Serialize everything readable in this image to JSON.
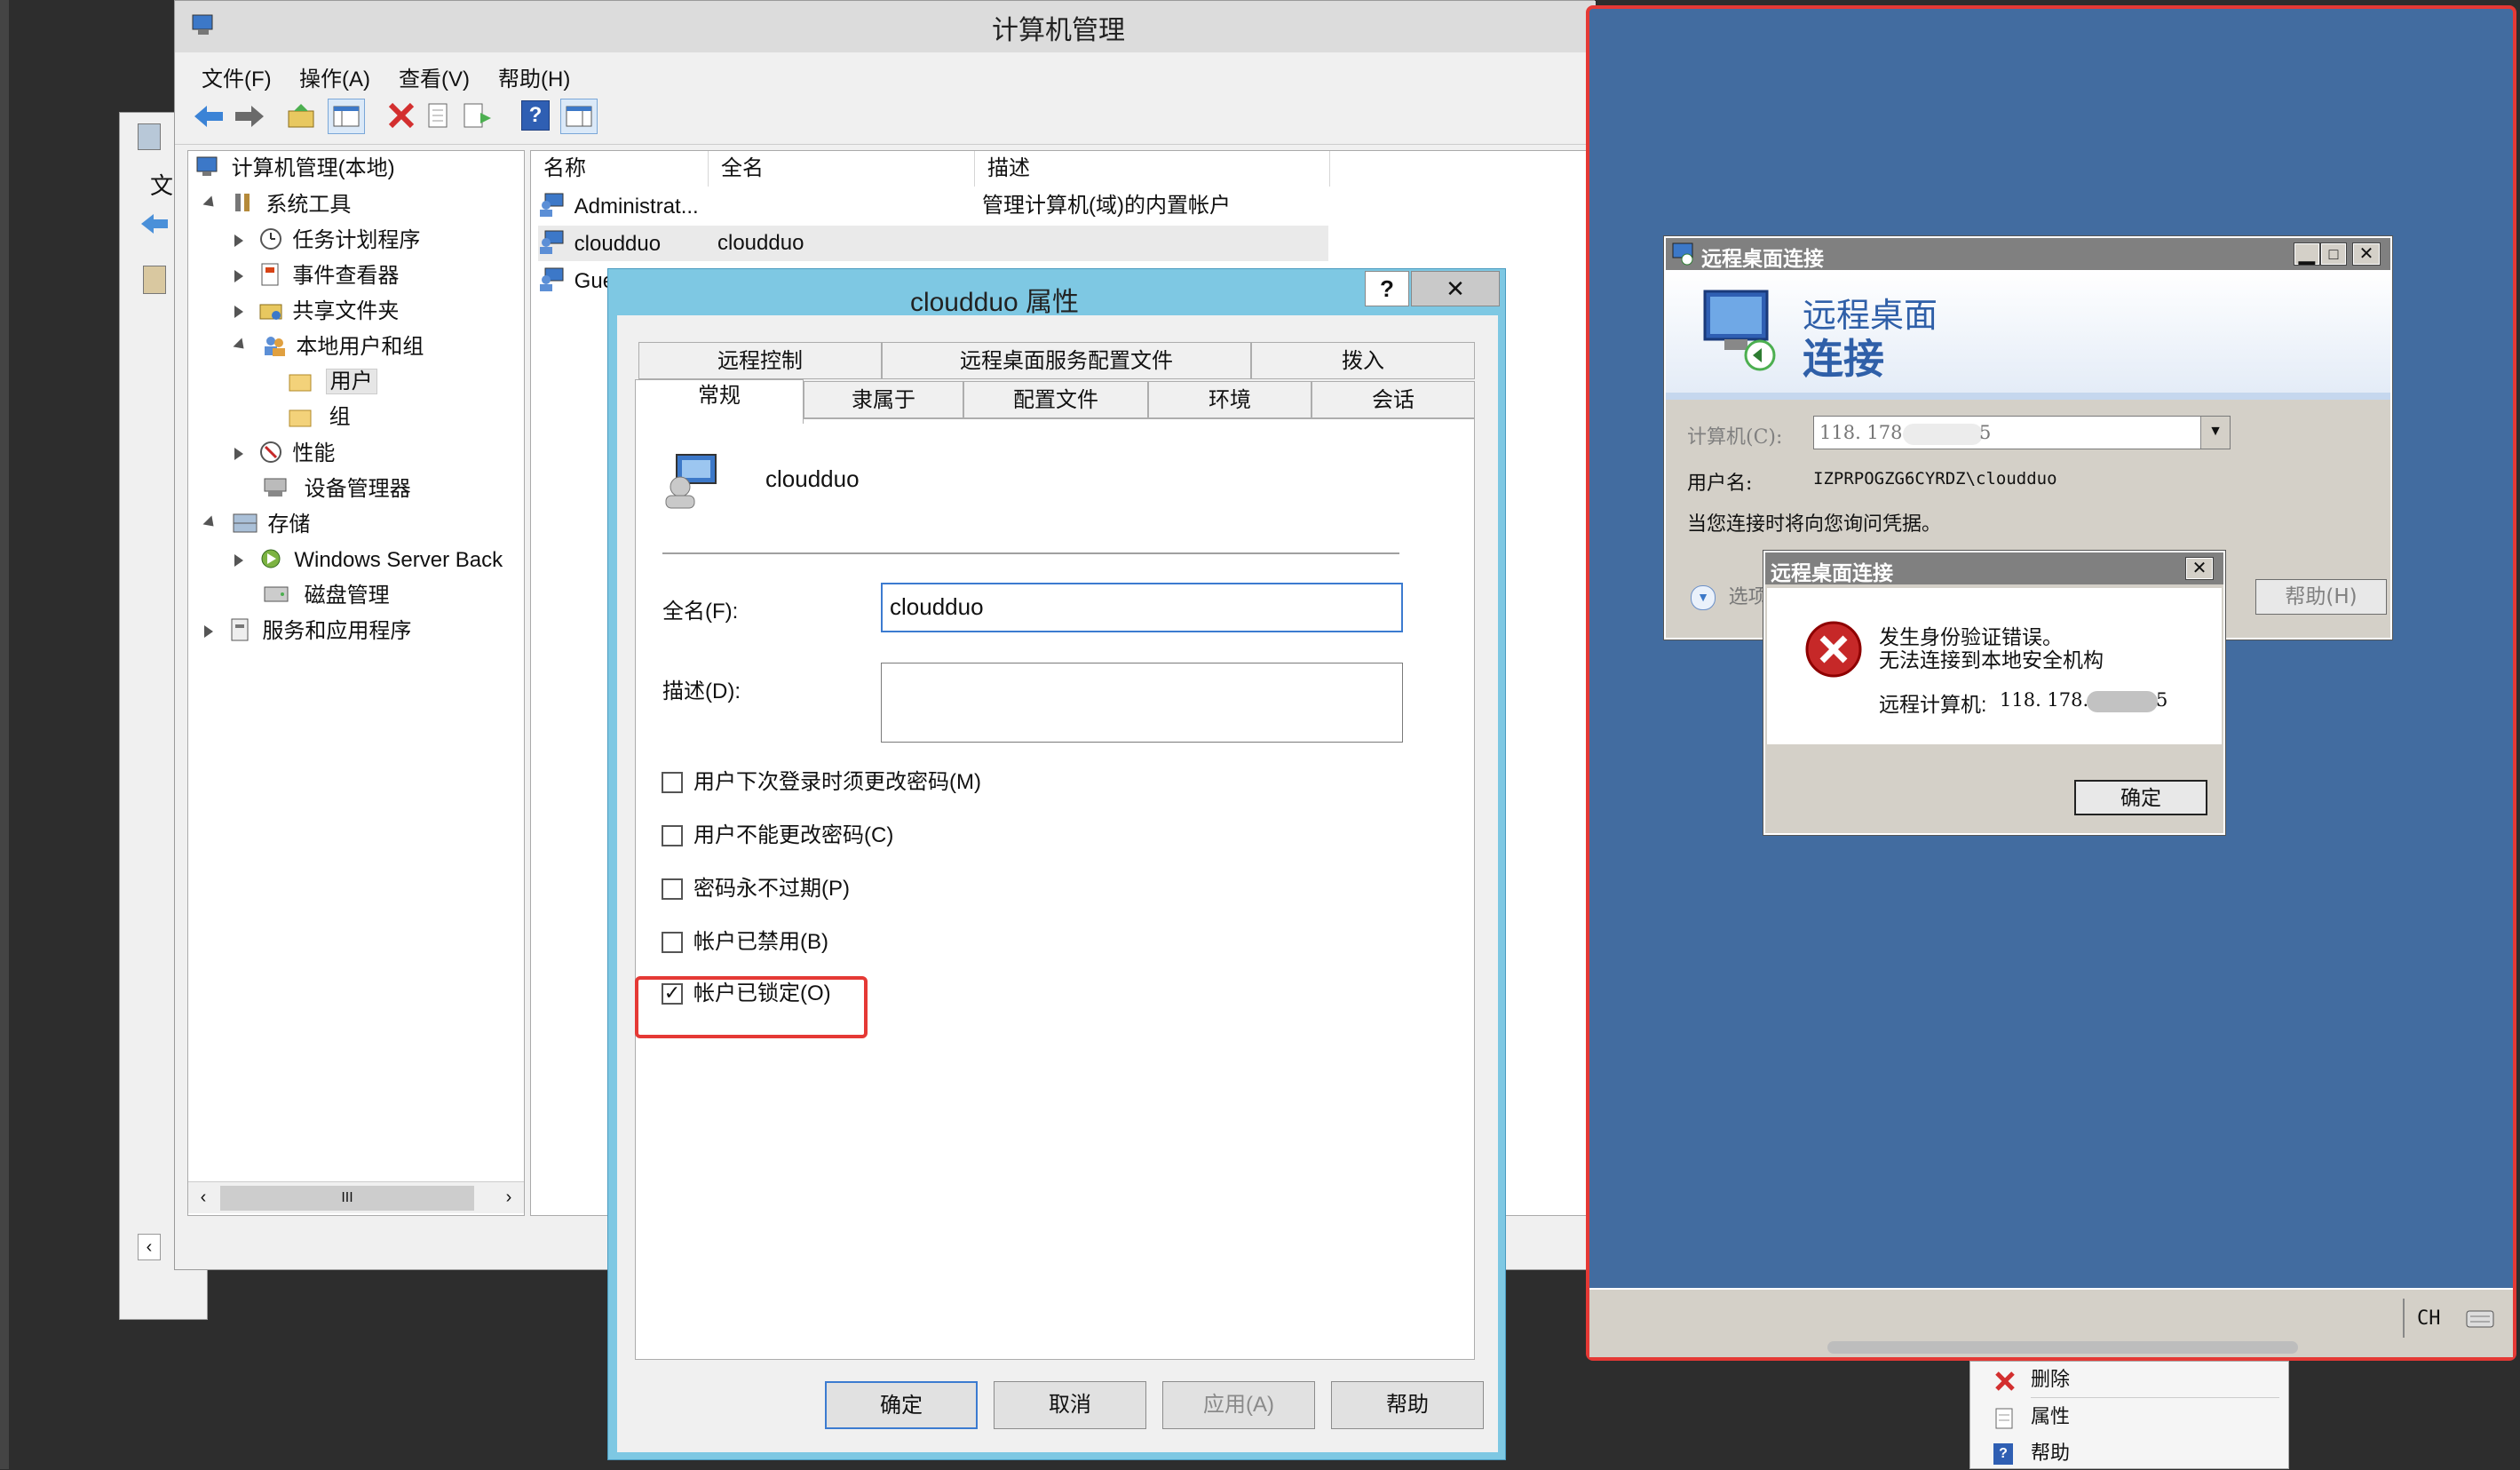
{
  "main_window": {
    "title": "计算机管理",
    "menu": [
      "文件(F)",
      "操作(A)",
      "查看(V)",
      "帮助(H)"
    ],
    "tree": [
      {
        "label": "计算机管理(本地)"
      },
      {
        "label": "系统工具"
      },
      {
        "label": "任务计划程序"
      },
      {
        "label": "事件查看器"
      },
      {
        "label": "共享文件夹"
      },
      {
        "label": "本地用户和组"
      },
      {
        "label": "用户"
      },
      {
        "label": "组"
      },
      {
        "label": "性能"
      },
      {
        "label": "设备管理器"
      },
      {
        "label": "存储"
      },
      {
        "label": "Windows Server Back"
      },
      {
        "label": "磁盘管理"
      },
      {
        "label": "服务和应用程序"
      }
    ],
    "scroll_thumb": "III",
    "list_headers": [
      "名称",
      "全名",
      "描述"
    ],
    "list_rows": [
      {
        "name": "Administrat...",
        "fullname": "",
        "desc": "管理计算机(域)的内置帐户"
      },
      {
        "name": "cloudduo",
        "fullname": "cloudduo",
        "desc": ""
      },
      {
        "name": "Gue",
        "fullname": "",
        "desc": ""
      }
    ]
  },
  "background_window": {
    "partial_label": "文"
  },
  "properties_dialog": {
    "title": "cloudduo 属性",
    "help_glyph": "?",
    "close_glyph": "✕",
    "tabs_back": [
      "远程控制",
      "远程桌面服务配置文件",
      "拨入"
    ],
    "tabs_front": [
      "常规",
      "隶属于",
      "配置文件",
      "环境",
      "会话"
    ],
    "username": "cloudduo",
    "fullname_label": "全名(F):",
    "fullname_value": "cloudduo",
    "desc_label": "描述(D):",
    "desc_value": "",
    "checkboxes": [
      {
        "label": "用户下次登录时须更改密码(M)",
        "checked": false
      },
      {
        "label": "用户不能更改密码(C)",
        "checked": false
      },
      {
        "label": "密码永不过期(P)",
        "checked": false
      },
      {
        "label": "帐户已禁用(B)",
        "checked": false
      },
      {
        "label": "帐户已锁定(O)",
        "checked": true
      }
    ],
    "buttons": [
      "确定",
      "取消",
      "应用(A)",
      "帮助"
    ]
  },
  "rdc_window": {
    "title": "远程桌面连接",
    "banner_line1": "远程桌面",
    "banner_line2": "连接",
    "computer_label": "计算机(C):",
    "computer_value": "118. 178.",
    "computer_tail": "5",
    "username_label": "用户名:",
    "username_value": "IZPRPOGZG6CYRDZ\\cloudduo",
    "credentials_note": "当您连接时将向您询问凭据。",
    "options_label": "选项",
    "help_button": "帮助(H)"
  },
  "error_dialog": {
    "title": "远程桌面连接",
    "line1": "发生身份验证错误。",
    "line2": "无法连接到本地安全机构",
    "remote_label": "远程计算机:",
    "remote_value": "118. 178.",
    "remote_tail": "5",
    "ok_button": "确定"
  },
  "remote_taskbar": {
    "lang": "CH"
  },
  "context_menu": {
    "items": [
      "删除",
      "属性",
      "帮助"
    ]
  },
  "colors": {
    "remote_desktop_bg": "#426ca0",
    "highlight_red": "#e53935",
    "dialog_title_bg": "#7ec8e3",
    "error_red": "#c62828"
  }
}
